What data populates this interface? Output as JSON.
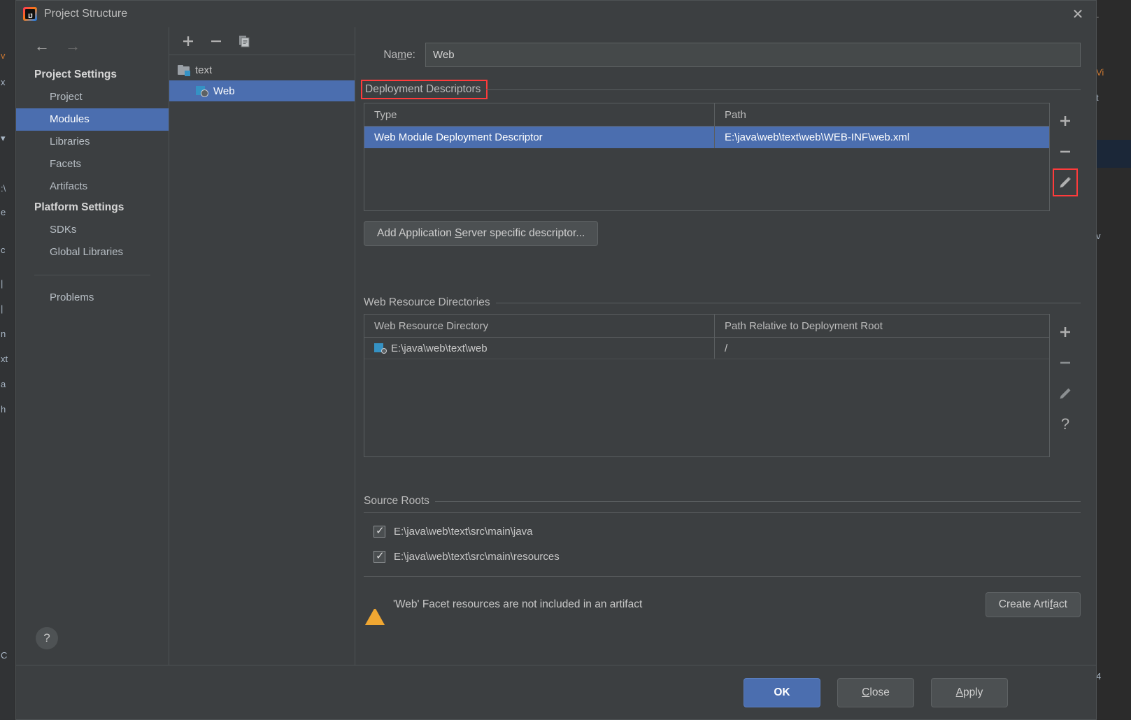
{
  "window": {
    "title": "Project Structure",
    "app_icon": "intellij-idea-icon",
    "close_icon": "✕"
  },
  "sidebar": {
    "back_icon": "←",
    "forward_icon": "→",
    "groups": [
      {
        "title": "Project Settings",
        "items": [
          {
            "label": "Project",
            "selected": false
          },
          {
            "label": "Modules",
            "selected": true
          },
          {
            "label": "Libraries",
            "selected": false
          },
          {
            "label": "Facets",
            "selected": false
          },
          {
            "label": "Artifacts",
            "selected": false
          }
        ]
      },
      {
        "title": "Platform Settings",
        "items": [
          {
            "label": "SDKs",
            "selected": false
          },
          {
            "label": "Global Libraries",
            "selected": false
          }
        ]
      }
    ],
    "problems_label": "Problems",
    "help_label": "?"
  },
  "tree": {
    "toolbar": {
      "add_label": "+",
      "remove_label": "−",
      "copy_label": "copy-icon"
    },
    "nodes": [
      {
        "label": "text",
        "icon": "module-folder-icon",
        "selected": false,
        "child": false
      },
      {
        "label": "Web",
        "icon": "web-facet-icon",
        "selected": true,
        "child": true
      }
    ]
  },
  "main": {
    "name_label": "Name:",
    "name_label_mnemonic": "m",
    "name_value": "Web",
    "deployment": {
      "section_title": "Deployment Descriptors",
      "highlighted": true,
      "columns": [
        "Type",
        "Path"
      ],
      "rows": [
        {
          "type": "Web Module Deployment Descriptor",
          "path": "E:\\java\\web\\text\\web\\WEB-INF\\web.xml",
          "selected": true
        }
      ],
      "tools": [
        {
          "name": "add",
          "glyph": "+",
          "highlighted": false
        },
        {
          "name": "remove",
          "glyph": "−",
          "highlighted": false
        },
        {
          "name": "edit",
          "glyph": "pencil",
          "highlighted": true
        }
      ],
      "add_descriptor_button": "Add Application Server specific descriptor...",
      "add_descriptor_mnemonic": "S"
    },
    "web_resources": {
      "section_title": "Web Resource Directories",
      "columns": [
        "Web Resource Directory",
        "Path Relative to Deployment Root"
      ],
      "rows": [
        {
          "directory": "E:\\java\\web\\text\\web",
          "relative_path": "/"
        }
      ],
      "tools": [
        {
          "name": "add",
          "glyph": "+"
        },
        {
          "name": "remove",
          "glyph": "−"
        },
        {
          "name": "edit",
          "glyph": "pencil"
        },
        {
          "name": "help",
          "glyph": "?"
        }
      ]
    },
    "source_roots": {
      "section_title": "Source Roots",
      "items": [
        {
          "label": "E:\\java\\web\\text\\src\\main\\java",
          "checked": true
        },
        {
          "label": "E:\\java\\web\\text\\src\\main\\resources",
          "checked": true
        }
      ]
    },
    "warning": {
      "icon": "warning-triangle-icon",
      "text": "'Web' Facet resources are not included in an artifact",
      "action_label": "Create Artifact",
      "action_mnemonic": "f"
    }
  },
  "footer": {
    "ok_label": "OK",
    "close_label": "Close",
    "close_mnemonic": "C",
    "apply_label": "Apply",
    "apply_mnemonic": "A"
  },
  "colors": {
    "selection": "#4b6eaf",
    "highlight_box": "#ff3b3b",
    "warning": "#f0a732",
    "dialog_bg": "#3c3f41"
  }
}
